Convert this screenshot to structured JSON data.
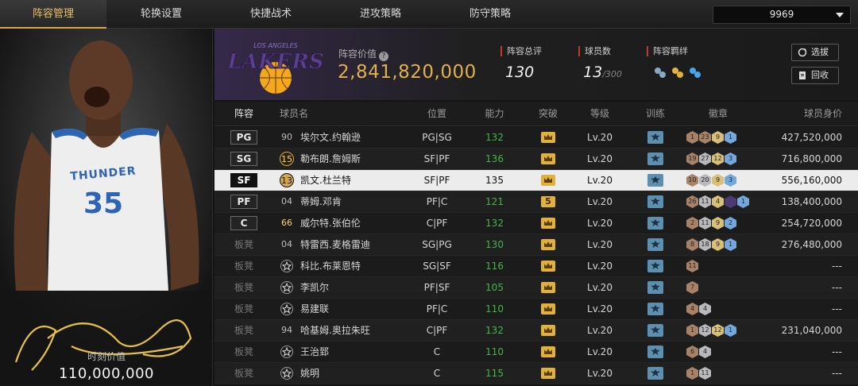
{
  "nav": {
    "tabs": [
      "阵容管理",
      "轮换设置",
      "快捷战术",
      "进攻策略",
      "防守策略"
    ],
    "active_tab": 0,
    "dropdown_value": "9969"
  },
  "card": {
    "jersey_team": "THUNDER",
    "jersey_number": "35",
    "label": "时刻价值",
    "value": "110,000,000"
  },
  "team": {
    "logo_city": "LOS ANGELES",
    "logo_name": "LAKERS",
    "value_label": "阵容价值",
    "value": "2,841,820,000",
    "rating_label": "阵容总评",
    "rating": "130",
    "count_label": "球员数",
    "count": "13",
    "count_max": "/300",
    "bond_label": "阵容羁绊",
    "btn_select": "选拔",
    "btn_recycle": "回收"
  },
  "table": {
    "headers": [
      "阵容",
      "球员名",
      "位置",
      "能力",
      "突破",
      "等级",
      "训练",
      "徽章",
      "球员身价"
    ],
    "rows": [
      {
        "slot": "PG",
        "starter": true,
        "num": "90",
        "num_style": "plain",
        "name": "埃尔文.约翰逊",
        "pos": "PG|SG",
        "ability": "132",
        "breakthrough": "crown",
        "level": "Lv.20",
        "badges": [
          [
            "bronze",
            "1"
          ],
          [
            "bronze",
            "23"
          ],
          [
            "gold",
            "9"
          ],
          [
            "blue",
            "1"
          ]
        ],
        "salary": "427,520,000"
      },
      {
        "slot": "SG",
        "starter": true,
        "num": "15",
        "num_style": "gold",
        "name": "勒布朗.詹姆斯",
        "pos": "SF|PF",
        "ability": "136",
        "breakthrough": "crown",
        "level": "Lv.20",
        "badges": [
          [
            "bronze",
            "19"
          ],
          [
            "silver",
            "27"
          ],
          [
            "gold",
            "12"
          ],
          [
            "blue",
            "3"
          ]
        ],
        "salary": "716,800,000"
      },
      {
        "slot": "SF",
        "starter": true,
        "selected": true,
        "num": "13",
        "num_style": "black",
        "name": "凯文.杜兰特",
        "pos": "SF|PF",
        "ability": "135",
        "breakthrough": "crown",
        "level": "Lv.20",
        "badges": [
          [
            "bronze",
            "10"
          ],
          [
            "silver",
            "20"
          ],
          [
            "gold",
            "9"
          ],
          [
            "blue",
            "3"
          ]
        ],
        "salary": "556,160,000"
      },
      {
        "slot": "PF",
        "starter": true,
        "num": "04",
        "num_style": "plain",
        "name": "蒂姆.邓肯",
        "pos": "PF|C",
        "ability": "121",
        "breakthrough": "5",
        "level": "Lv.20",
        "badges": [
          [
            "bronze",
            "26"
          ],
          [
            "silver",
            "11"
          ],
          [
            "gold",
            "4"
          ],
          [
            "purple",
            ""
          ],
          [
            "blue",
            "1"
          ]
        ],
        "salary": "138,400,000"
      },
      {
        "slot": "C",
        "starter": true,
        "num": "66",
        "num_style": "goldtext",
        "name": "威尔特.张伯伦",
        "pos": "C|PF",
        "ability": "132",
        "breakthrough": "crown",
        "level": "Lv.20",
        "badges": [
          [
            "bronze",
            "2"
          ],
          [
            "silver",
            "11"
          ],
          [
            "gold",
            "9"
          ],
          [
            "blue",
            "2"
          ]
        ],
        "salary": "254,720,000"
      },
      {
        "slot": "板凳",
        "starter": false,
        "num": "04",
        "num_style": "plain",
        "name": "特雷西.麦格雷迪",
        "pos": "SG|PG",
        "ability": "130",
        "breakthrough": "crown",
        "level": "Lv.20",
        "badges": [
          [
            "bronze",
            "8"
          ],
          [
            "silver",
            "18"
          ],
          [
            "gold",
            "9"
          ],
          [
            "blue",
            "1"
          ]
        ],
        "salary": "276,480,000"
      },
      {
        "slot": "板凳",
        "starter": false,
        "num": "star",
        "num_style": "star",
        "name": "科比.布莱恩特",
        "pos": "SG|SF",
        "ability": "116",
        "breakthrough": "crown",
        "level": "Lv.20",
        "badges": [
          [
            "bronze",
            "11"
          ]
        ],
        "salary": "---"
      },
      {
        "slot": "板凳",
        "starter": false,
        "num": "star",
        "num_style": "star",
        "name": "李凯尔",
        "pos": "PF|SF",
        "ability": "105",
        "breakthrough": "crown",
        "level": "Lv.20",
        "badges": [
          [
            "bronze",
            "7"
          ]
        ],
        "salary": "---"
      },
      {
        "slot": "板凳",
        "starter": false,
        "num": "star",
        "num_style": "star",
        "name": "易建联",
        "pos": "PF|C",
        "ability": "110",
        "breakthrough": "crown",
        "level": "Lv.20",
        "badges": [
          [
            "bronze",
            "4"
          ],
          [
            "silver",
            "4"
          ]
        ],
        "salary": "---"
      },
      {
        "slot": "板凳",
        "starter": false,
        "num": "94",
        "num_style": "plain",
        "name": "哈基姆.奥拉朱旺",
        "pos": "C|PF",
        "ability": "132",
        "breakthrough": "crown",
        "level": "Lv.20",
        "badges": [
          [
            "bronze",
            "1"
          ],
          [
            "silver",
            "12"
          ],
          [
            "gold",
            "12"
          ],
          [
            "blue",
            "1"
          ]
        ],
        "salary": "231,040,000"
      },
      {
        "slot": "板凳",
        "starter": false,
        "num": "star",
        "num_style": "star",
        "name": "王治郅",
        "pos": "C",
        "ability": "110",
        "breakthrough": "crown",
        "level": "Lv.20",
        "badges": [
          [
            "bronze",
            "6"
          ],
          [
            "silver",
            "4"
          ]
        ],
        "salary": "---"
      },
      {
        "slot": "板凳",
        "starter": false,
        "num": "star",
        "num_style": "star",
        "name": "姚明",
        "pos": "C",
        "ability": "115",
        "breakthrough": "crown",
        "level": "Lv.20",
        "badges": [
          [
            "bronze",
            "1"
          ],
          [
            "silver",
            "11"
          ]
        ],
        "salary": "---"
      }
    ]
  },
  "colors": {
    "accent_gold": "#e1b04e",
    "ability_green": "#47b449",
    "lakers_purple": "#5b3f8c"
  }
}
